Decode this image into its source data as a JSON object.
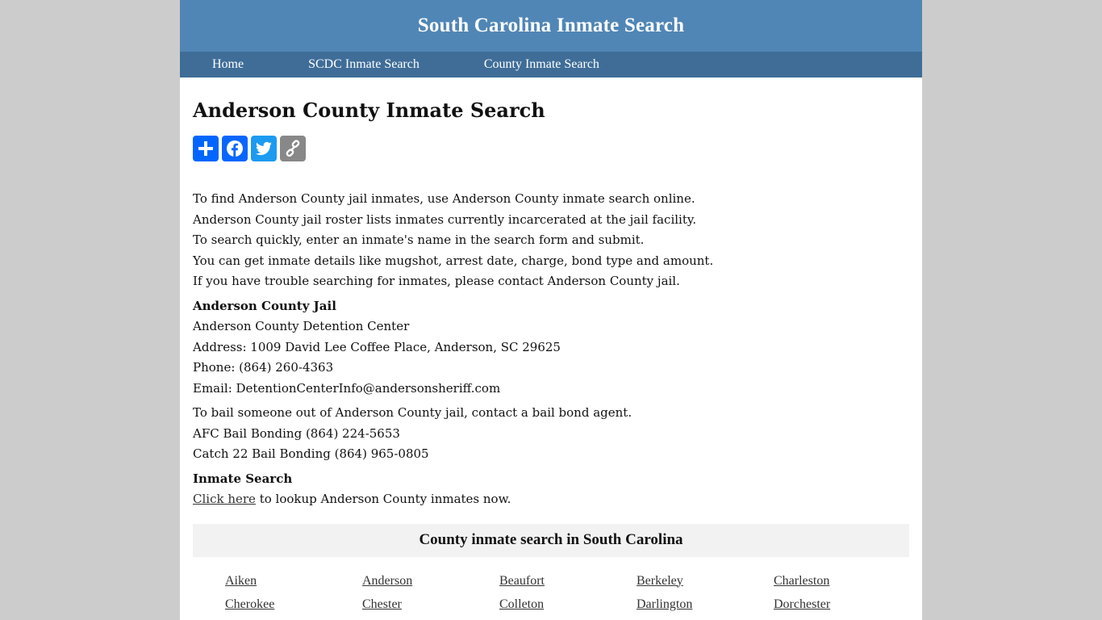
{
  "header": {
    "site_title": "South Carolina Inmate Search"
  },
  "nav": {
    "items": [
      {
        "label": "Home"
      },
      {
        "label": "SCDC Inmate Search"
      },
      {
        "label": "County Inmate Search"
      }
    ]
  },
  "main": {
    "title": "Anderson County Inmate Search",
    "share": {
      "buttons": [
        {
          "name": "share",
          "icon": "plus-icon",
          "color": "#0166ff"
        },
        {
          "name": "facebook",
          "icon": "facebook-icon",
          "color": "#0866ff"
        },
        {
          "name": "twitter",
          "icon": "twitter-icon",
          "color": "#1d9bf0"
        },
        {
          "name": "copy-link",
          "icon": "link-icon",
          "color": "#888888"
        }
      ]
    },
    "intro_lines": [
      "To find Anderson County jail inmates, use Anderson County inmate search online.",
      "Anderson County jail roster lists inmates currently incarcerated at the jail facility.",
      "To search quickly, enter an inmate's name in the search form and submit.",
      "You can get inmate details like mugshot, arrest date, charge, bond type and amount.",
      "If you have trouble searching for inmates, please contact Anderson County jail."
    ],
    "jail": {
      "heading": "Anderson County Jail",
      "name": "Anderson County Detention Center",
      "address": "Address: 1009 David Lee Coffee Place, Anderson, SC 29625",
      "phone": "Phone: (864) 260-4363",
      "email": "Email: DetentionCenterInfo@andersonsheriff.com"
    },
    "bail": {
      "intro": "To bail someone out of Anderson County jail, contact a bail bond agent.",
      "agents": [
        "AFC Bail Bonding (864) 224-5653",
        "Catch 22 Bail Bonding (864) 965-0805"
      ]
    },
    "inmate_search": {
      "heading": "Inmate Search",
      "link_label": "Click here",
      "link_suffix": " to lookup Anderson County inmates now."
    },
    "county_section": {
      "heading": "County inmate search in South Carolina",
      "counties": [
        "Aiken",
        "Anderson",
        "Beaufort",
        "Berkeley",
        "Charleston",
        "Cherokee",
        "Chester",
        "Colleton",
        "Darlington",
        "Dorchester"
      ]
    }
  }
}
